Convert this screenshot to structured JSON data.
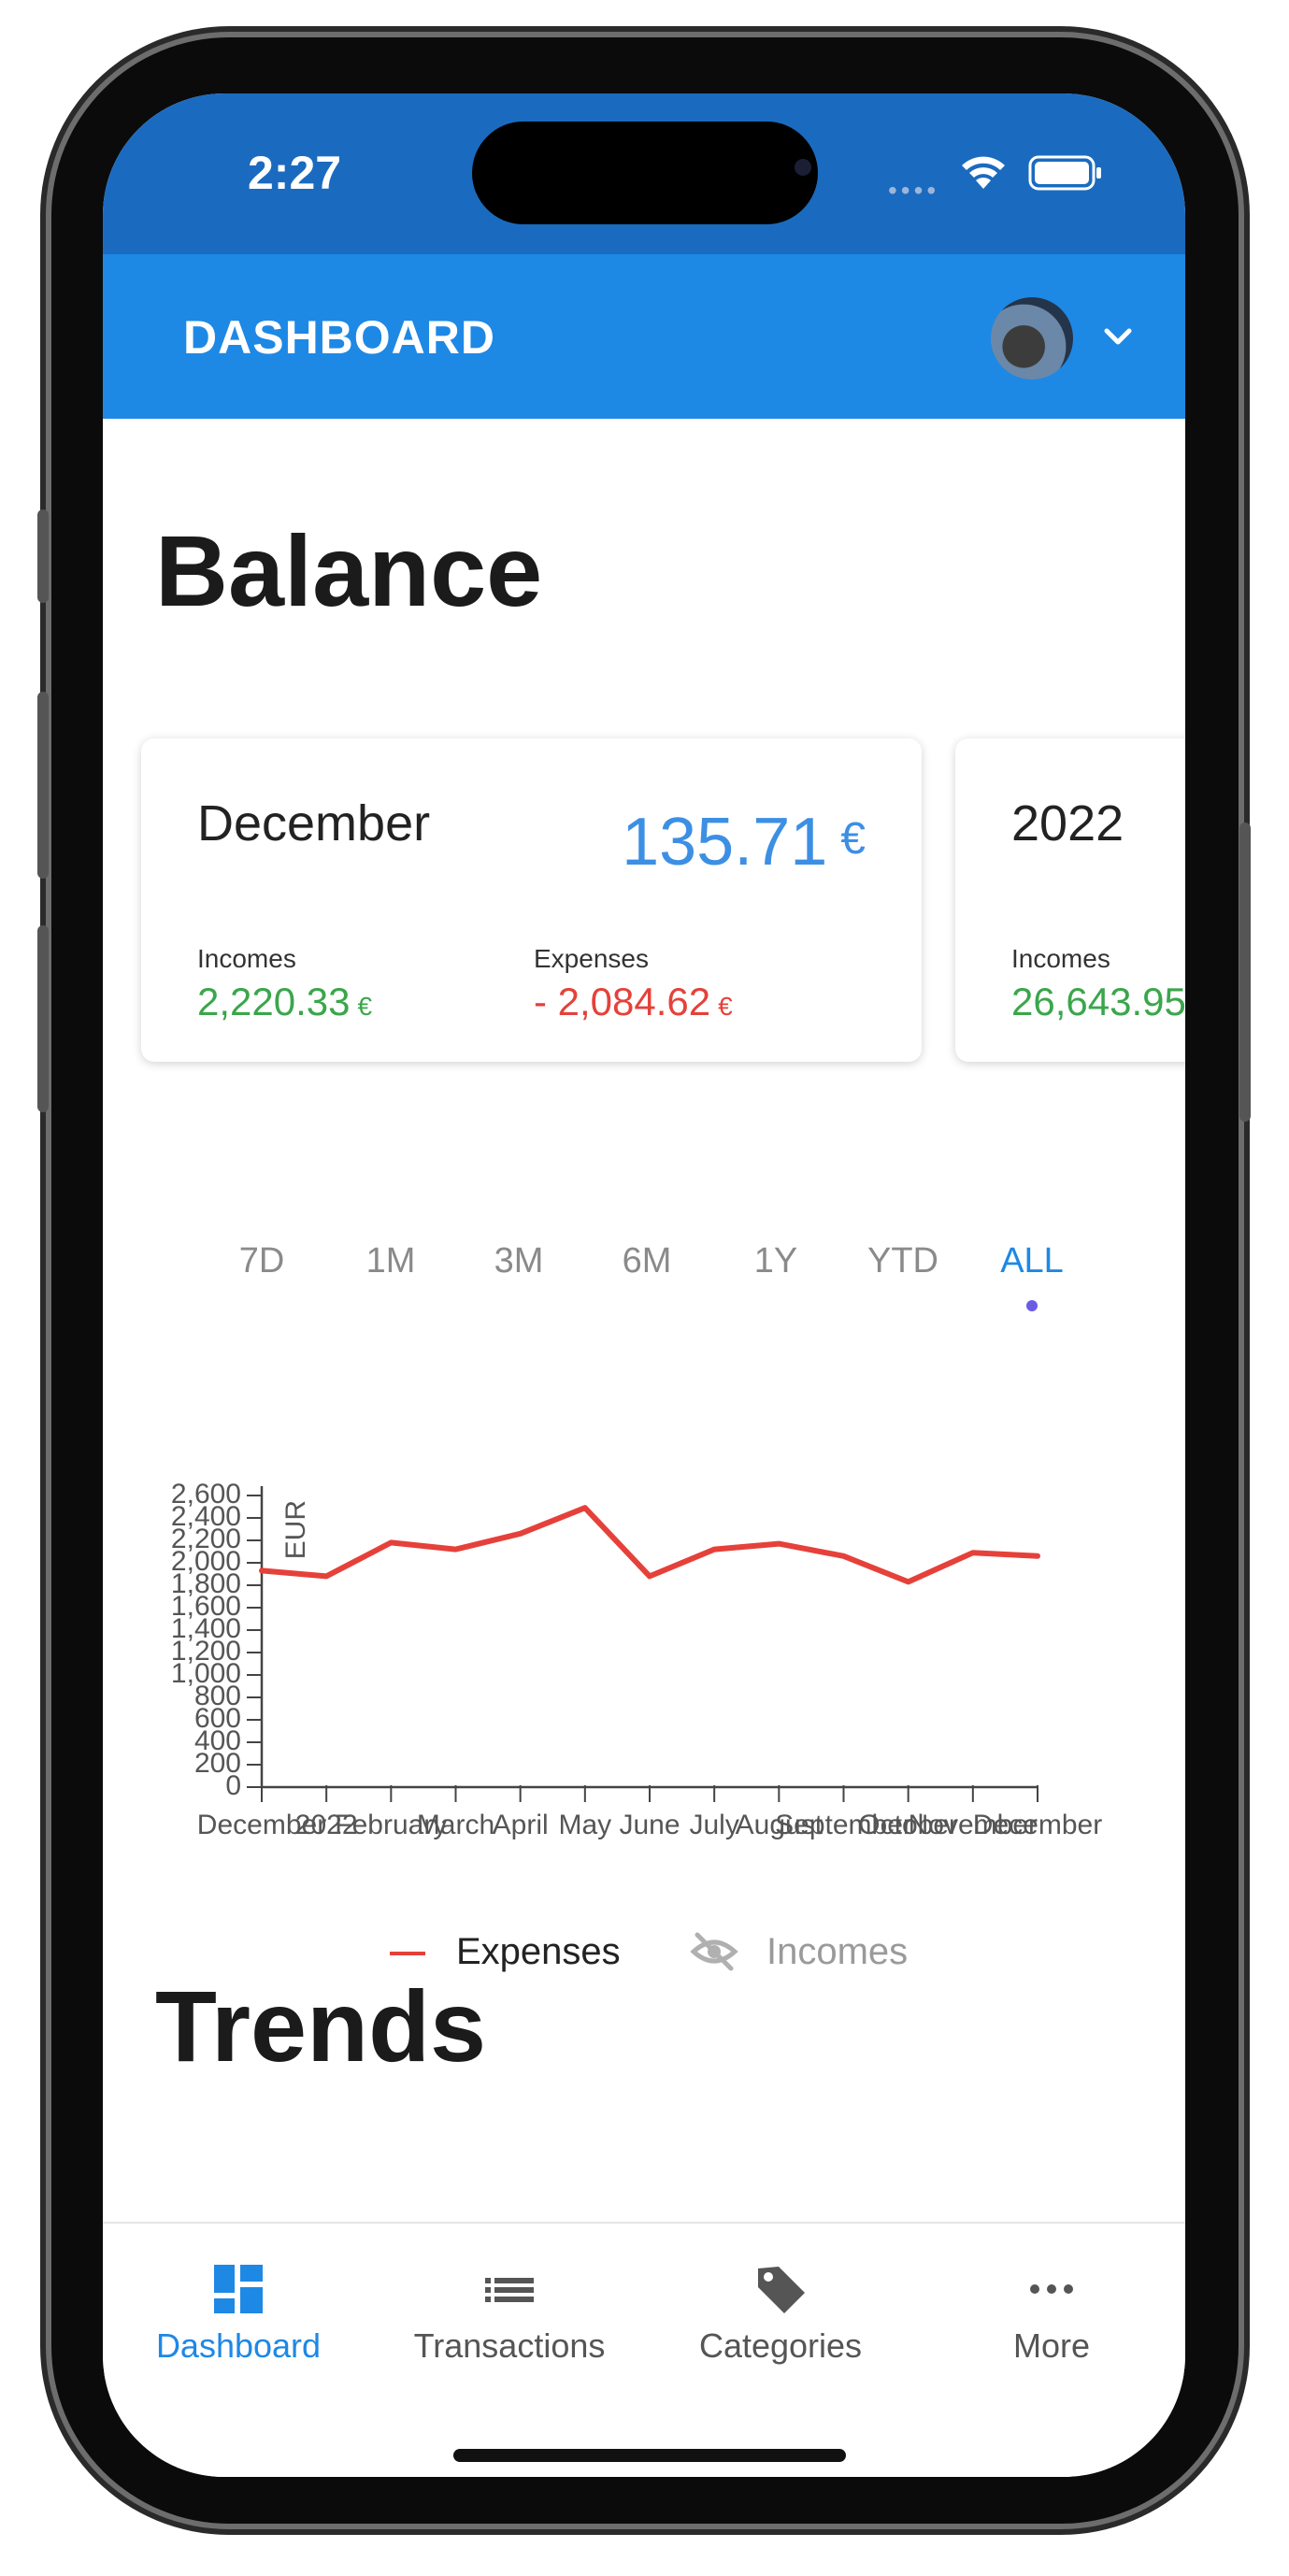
{
  "status_bar": {
    "time": "2:27"
  },
  "app_bar": {
    "title": "DASHBOARD"
  },
  "balance": {
    "heading": "Balance",
    "cards": [
      {
        "title": "December",
        "amount": "135.71",
        "currency": "€",
        "incomes_label": "Incomes",
        "incomes_value": "2,220.33",
        "incomes_currency": "€",
        "expenses_label": "Expenses",
        "expenses_value": "- 2,084.62",
        "expenses_currency": "€"
      },
      {
        "title": "2022",
        "incomes_label": "Incomes",
        "incomes_value": "26,643.95"
      }
    ]
  },
  "periods": {
    "items": [
      "7D",
      "1M",
      "3M",
      "6M",
      "1Y",
      "YTD",
      "ALL"
    ],
    "selected": "ALL"
  },
  "chart_data": {
    "type": "line",
    "ylabel": "EUR",
    "ylim": [
      0,
      2600
    ],
    "yticks": [
      "0",
      "200",
      "400",
      "600",
      "800",
      "1,000",
      "1,200",
      "1,400",
      "1,600",
      "1,800",
      "2,000",
      "2,200",
      "2,400",
      "2,600"
    ],
    "categories": [
      "December",
      "2022",
      "February",
      "March",
      "April",
      "May",
      "June",
      "July",
      "August",
      "September",
      "October",
      "November",
      "December"
    ],
    "series": [
      {
        "name": "Expenses",
        "color": "#e5413a",
        "visible": true,
        "values": [
          1930,
          1880,
          2180,
          2120,
          2260,
          2490,
          1880,
          2120,
          2170,
          2060,
          1830,
          2090,
          2060
        ]
      },
      {
        "name": "Incomes",
        "visible": false
      }
    ],
    "legend": [
      {
        "label": "Expenses",
        "state": "shown"
      },
      {
        "label": "Incomes",
        "state": "hidden",
        "icon": "eye-off-icon"
      }
    ],
    "legend_position": "bottom"
  },
  "trends": {
    "heading": "Trends"
  },
  "bottom_nav": {
    "items": [
      {
        "label": "Dashboard",
        "icon": "dashboard-icon",
        "active": true
      },
      {
        "label": "Transactions",
        "icon": "list-icon",
        "active": false
      },
      {
        "label": "Categories",
        "icon": "tag-icon",
        "active": false
      },
      {
        "label": "More",
        "icon": "more-icon",
        "active": false
      }
    ]
  },
  "colors": {
    "primary": "#1e88e5",
    "status_bar": "#1a6bbf",
    "income": "#3aa64b",
    "expense": "#e5413a",
    "balance": "#3d8fe4"
  }
}
